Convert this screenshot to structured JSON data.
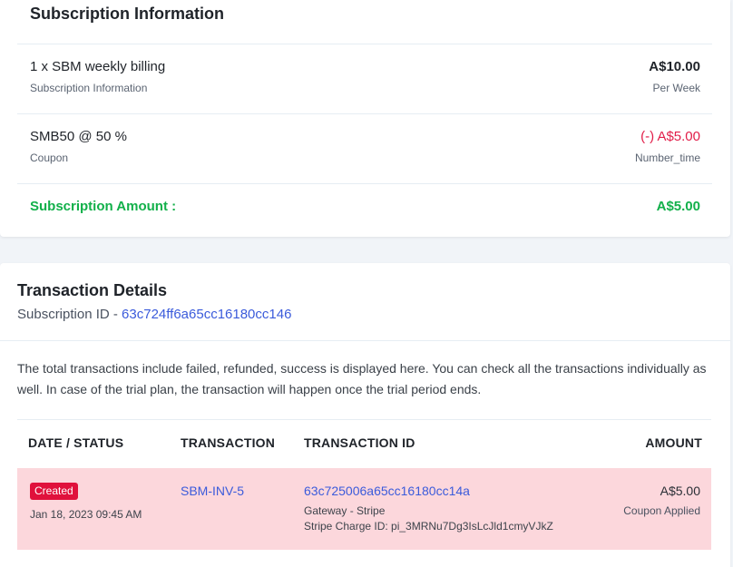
{
  "subscription": {
    "title": "Subscription Information",
    "items": [
      {
        "name": "1 x SBM weekly billing",
        "subtitle": "Subscription Information",
        "amount": "A$10.00",
        "period": "Per Week"
      },
      {
        "name": "SMB50 @ 50 %",
        "subtitle": "Coupon",
        "amount": "(-) A$5.00",
        "period": "Number_time"
      }
    ],
    "total_label": "Subscription Amount :",
    "total_value": "A$5.00"
  },
  "transactions": {
    "title": "Transaction Details",
    "subscription_id_label": "Subscription ID -",
    "subscription_id": "63c724ff6a65cc16180cc146",
    "description": "The total transactions include failed, refunded, success is displayed here. You can check all the transactions individually as well. In case of the trial plan, the transaction will happen once the trial period ends.",
    "columns": [
      "DATE / STATUS",
      "TRANSACTION",
      "TRANSACTION ID",
      "AMOUNT"
    ],
    "rows": [
      {
        "status": "Created",
        "date": "Jan 18, 2023 09:45 AM",
        "transaction": "SBM-INV-5",
        "transaction_id": "63c725006a65cc16180cc14a",
        "gateway": "Gateway - Stripe",
        "charge_id": "Stripe Charge ID: pi_3MRNu7Dg3IsLcJld1cmyVJkZ",
        "amount": "A$5.00",
        "amount_note": "Coupon Applied"
      }
    ]
  },
  "colors": {
    "accent_green": "#12b04a",
    "coupon_red": "#e11d48",
    "link_blue": "#3b5bdb",
    "status_created": "#e0113c",
    "row_highlight": "#fcd7dc"
  }
}
